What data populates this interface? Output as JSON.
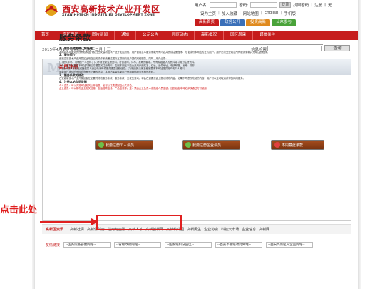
{
  "header": {
    "logo_cn": "西安高新技术产业开发区",
    "logo_en": "XI'AN HI-TECH INDUSTRIES DEVELOPMENT ZONE"
  },
  "login": {
    "user_label": "用户名:",
    "pass_label": "密码:",
    "login_btn": "登录",
    "forgot": "找回密码",
    "register": "注册",
    "divider": "无"
  },
  "toplinks": [
    "设为主页",
    "加入收藏",
    "网站地图",
    "English",
    "手机版"
  ],
  "section_tabs": [
    {
      "label": "高新首页",
      "color": "#c61d1d"
    },
    {
      "label": "政务公开",
      "color": "#3a6fb8"
    },
    {
      "label": "投资高新",
      "color": "#e08a1e"
    },
    {
      "label": "公众参与",
      "color": "#4aa33a"
    }
  ],
  "nav": [
    "首页",
    "高新要闻",
    "图片新闻",
    "通知",
    "公示公告",
    "园区动态",
    "高新概况",
    "园区风采",
    "媒体关注"
  ],
  "infobar": {
    "date": "2015年4月1日 星期三 乙未年二月十三",
    "search_label": "信息检索",
    "search_btn": "查询"
  },
  "panel": {
    "big_letter": "M",
    "big_word": "EMBER",
    "title": "会员注册",
    "terms_title": "服务条款"
  },
  "terms": {
    "s1": "1、服务条款的确认和接纳",
    "p1": "本网站各项服务的所有权和运作权归西安高新技术产业开发区所有。用户需同意本服务条款所有内容并完成注册程序，方能成为本网站的正式用户。用户必须完全同意所有服务条款并完成注册程序。",
    "s2": "2、服务简介",
    "p2": "西安高新技术产业开发区运用自己的操作系统通过国际互联网向用户提供网络服务。同时，用户必须：",
    "p3": "(1)提供详尽、准确的个人资料；(2)不断更新注册资料，符合及时、详尽、准确的要求。所有原始键入的资料将引用为注册资料。",
    "p4": "另外，用户可授权本网站向第三方透露其注册资料，否则本网站不能公开用户的姓名、住址、出件地址、电子邮箱、帐号。除非：",
    "p5": "(1)用户要求本网站或授权某人通过电子邮件服务透露这些信息；(2)相应的法律及程序要求本网站提供用户的个人资料。",
    "p6": "如果用户提供的资料包含有不正确的信息，本网站保留结束用户使用网络服务资格的权利。",
    "s3": "3、服务条款的修改",
    "p7": "西安高新技术产业开发区会在必要时修改服务条款，服务条款一旦发生变动，将会在重要页面上提示修改内容。如果不同意所改动的内容，用户可以主动取消获得的网络服务。",
    "s4": "4、注册本站会员说明",
    "p8": "个人会员：可以浏览网站相关公开信息，也可以发表或回复公共评论。",
    "p9": "企业会员：可以发布企业相关信息，包括招聘信息、产品信息等。注：须由企业负责人或指定人员注册，注册后由本网站审核通过方可使用。"
  },
  "buttons": {
    "personal": "我要注册个人会员",
    "enterprise": "我要注册企业会员",
    "disagree": "不同意此条款"
  },
  "annotation": {
    "callout": "点击此处"
  },
  "links": {
    "label": "高新区资讯",
    "items": [
      "高新社保",
      "高新保障房",
      "信用与金融",
      "高新人才",
      "高新创新网",
      "高新软件园",
      "高新民生",
      "企业协会",
      "科技大市场",
      "企业信息",
      "高新网"
    ]
  },
  "friend": {
    "label": "友情链接",
    "selects": [
      "--国务院各部委网站--",
      "--省级政府网站--",
      "--国家级科技园区--",
      "--西安市各级政府网站--",
      "--西安高新区内企业网站--"
    ]
  }
}
